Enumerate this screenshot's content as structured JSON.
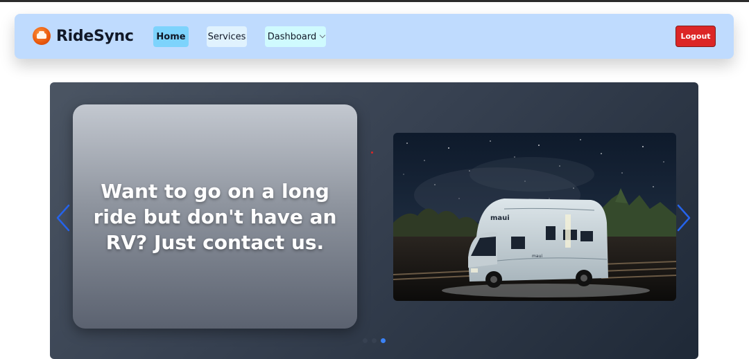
{
  "brand": {
    "name": "RideSync",
    "logo_icon": "car-logo-icon"
  },
  "nav": {
    "items": [
      {
        "label": "Home",
        "active": true
      },
      {
        "label": "Services",
        "active": false
      },
      {
        "label": "Dashboard",
        "active": false,
        "has_dropdown": true
      }
    ],
    "logout_label": "Logout"
  },
  "carousel": {
    "headline": "Want to go on a long ride but don't have an RV? Just contact us.",
    "image": {
      "name": "rv-camper-night-sky",
      "vehicle_lettering": "maui"
    },
    "slide_count": 3,
    "active_slide": 3,
    "prev_icon": "chevron-left-icon",
    "next_icon": "chevron-right-icon"
  },
  "colors": {
    "navbar_bg": "#bfdbfe",
    "home_bg": "#7dd3fc",
    "services_bg": "#e0f2fe",
    "dashboard_bg": "#cffafe",
    "logout_bg": "#dc2626",
    "carousel_bg": "#374151",
    "indicator_active": "#3b82f6",
    "arrow": "#2563eb"
  }
}
